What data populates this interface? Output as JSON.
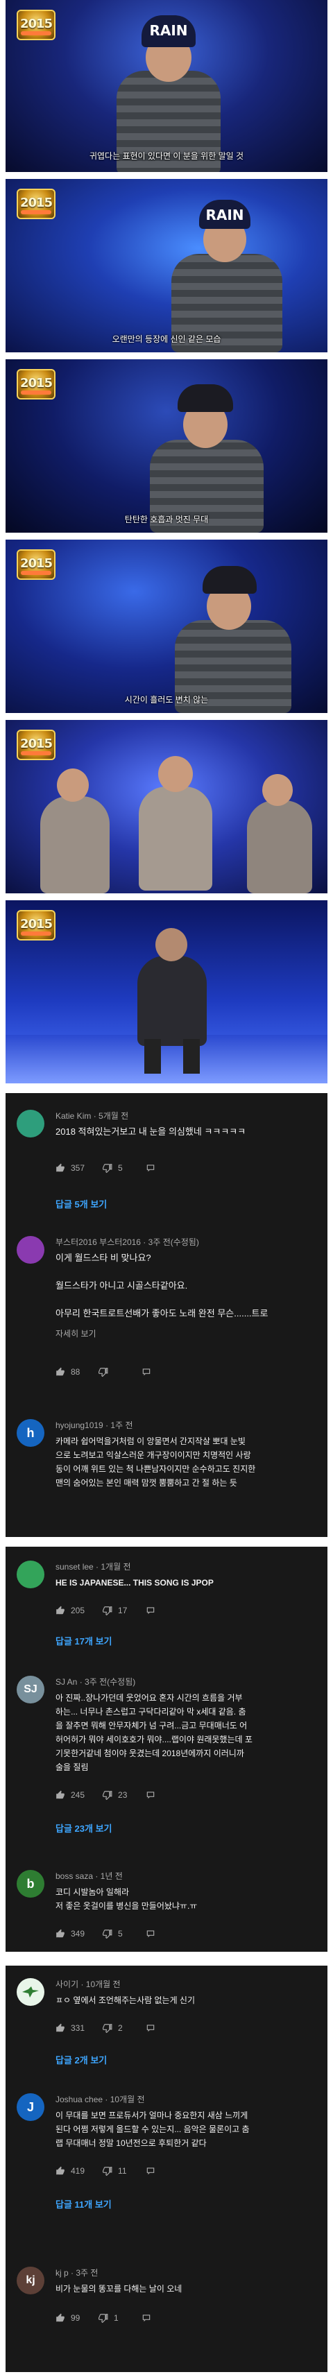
{
  "video": {
    "logo_text": "2015",
    "cap_text": "RAIN",
    "frames": [
      {
        "subtitle": "귀엽다는 표현이 있다면 이 분을 위한 말일 것"
      },
      {
        "subtitle": "오랜만의 등장에 신인 같은 모습"
      },
      {
        "subtitle": "탄탄한 호흡과 멋진 무대"
      },
      {
        "subtitle": "시간이 흘러도 변치 않는"
      },
      {
        "subtitle": ""
      },
      {
        "subtitle": ""
      }
    ]
  },
  "colors": {
    "panel_bg": "#181818",
    "link_blue": "#3ea6ff",
    "text_primary": "#f1f1f1",
    "text_secondary": "#aaaaaa"
  },
  "panels": [
    {
      "comments": [
        {
          "avatar_letter": "",
          "avatar_color": "#2e9e7c",
          "author": "Katie Kim",
          "time": "5개월 전",
          "lines": [
            "2018 적혀있는거보고 내 눈을 의심했네 ㅋㅋㅋㅋㅋ"
          ],
          "likes": "357",
          "replies_count": "5",
          "read_more": "",
          "replies_label": "답글 5개 보기"
        },
        {
          "avatar_letter": "",
          "avatar_color": "#8a3ab0",
          "author": "부스터2016 부스터2016",
          "time": "3주 전(수정됨)",
          "lines": [
            "이게 월드스타 비 맞나요?",
            "",
            "월드스타가 아니고 시골스타같아요.",
            "",
            "아무리 한국트로트선배가 좋아도 노래 완전 무슨.......트로"
          ],
          "likes": "88",
          "replies_count": "",
          "read_more": "자세히 보기",
          "replies_label": ""
        },
        {
          "avatar_letter": "h",
          "avatar_color": "#1565c0",
          "author": "hyojung1019",
          "time": "1주 전",
          "lines": [
            "카메라 쉽어먹을거처럼 이 앙물면서 간지작살 뽀대 눈빛",
            "으로 노려보고 익살스러운 개구장이이지만 치명적인 사랑",
            "동이 어깨 위트 있는 척 나쁜남자이지만 순수하고도 진지한",
            "맨의 숨어있는 본인 매력 맘껏 뿜뿜하고 간 절 하는 듯"
          ],
          "likes": "",
          "replies_count": "",
          "read_more": "",
          "replies_label": ""
        }
      ]
    },
    {
      "comments": [
        {
          "avatar_letter": "",
          "avatar_color": "#33a45a",
          "author": "sunset lee",
          "time": "1개월 전",
          "lines": [
            "HE IS JAPANESE... THIS SONG IS JPOP"
          ],
          "likes": "205",
          "replies_count": "17",
          "read_more": "",
          "replies_label": "답글 17개 보기"
        },
        {
          "avatar_letter": "SJ",
          "avatar_color": "#78909c",
          "author": "SJ An",
          "time": "3주 전(수정됨)",
          "lines": [
            "아 진짜..장나가던데 웃었어요 혼자 시간의 흐름을 거부",
            "하는... 너무나 촌스럽고 구닥다리같아 막 x세대 같음. 춤",
            "을 잘추면 뭐해 안무자체가 넘 구려...금고 무대매너도 어",
            "허어허가 뭐야 세이호호가 뭐야....랩이야 원래못했는데 포",
            "기못한거같네 첨이야 웃겼는데 2018년에까지 이러니까",
            "술을 질림"
          ],
          "likes": "245",
          "replies_count": "23",
          "read_more": "",
          "replies_label": "답글 23개 보기"
        },
        {
          "avatar_letter": "b",
          "avatar_color": "#2e7d32",
          "author": "boss saza",
          "time": "1년 전",
          "lines": [
            "코디 시발놈아 일해라",
            "저 좋은 옷걸이를 병신을 만들어놨냐ㅠ.ㅠ"
          ],
          "likes": "349",
          "replies_count": "5",
          "read_more": "",
          "replies_label": ""
        }
      ]
    },
    {
      "comments": [
        {
          "avatar_letter": "",
          "avatar_color": "#e8f5e9",
          "author": "사이기",
          "time": "10개월 전",
          "lines": [
            "ㅍㅇ 옆에서 조언해주는사람 없는게 신기"
          ],
          "likes": "331",
          "replies_count": "2",
          "read_more": "",
          "replies_label": "답글 2개 보기"
        },
        {
          "avatar_letter": "J",
          "avatar_color": "#1565c0",
          "author": "Joshua chee",
          "time": "10개월 전",
          "lines": [
            "이 무대를 보면 프로듀서가 얼마나 중요한지 새삼 느끼게",
            "된다 어쩜 저렇게 올드할 수 있는지... 음악은 물론이고 춤",
            "랩 무대매너 정말 10년전으로 후퇴한거 같다"
          ],
          "likes": "419",
          "replies_count": "11",
          "read_more": "",
          "replies_label": "답글 11개 보기"
        },
        {
          "avatar_letter": "kj",
          "avatar_color": "#5d4037",
          "author": "kj p",
          "time": "3주 전",
          "lines": [
            "비가 눈물의 똥꼬를 다해는 날이 오네"
          ],
          "likes": "99",
          "replies_count": "1",
          "read_more": "",
          "replies_label": ""
        }
      ]
    }
  ]
}
